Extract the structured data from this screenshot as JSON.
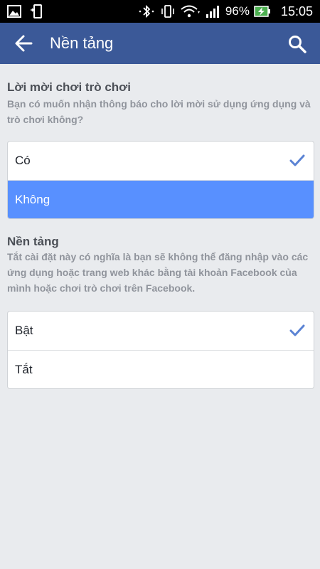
{
  "status_bar": {
    "battery_percent": "96%",
    "time": "15:05"
  },
  "app_bar": {
    "title": "Nền tảng"
  },
  "game_invites": {
    "title": "Lời mời chơi trò chơi",
    "description": "Bạn có muốn nhận thông báo cho lời mời sử dụng ứng dụng và trò chơi không?",
    "options": [
      {
        "label": "Có",
        "checked": true
      },
      {
        "label": "Không",
        "checked": false,
        "highlighted": true
      }
    ]
  },
  "platform": {
    "title": "Nền tảng",
    "description": "Tắt cài đặt này có nghĩa là bạn sẽ không thể đăng nhập vào các ứng dụng hoặc trang web khác bằng tài khoản Facebook của mình hoặc chơi trò chơi trên Facebook.",
    "options": [
      {
        "label": "Bật",
        "checked": true
      },
      {
        "label": "Tắt",
        "checked": false
      }
    ]
  },
  "colors": {
    "app_bar": "#3b5998",
    "highlight": "#5890ff",
    "check": "#5b83d4",
    "background": "#e9ebee"
  }
}
